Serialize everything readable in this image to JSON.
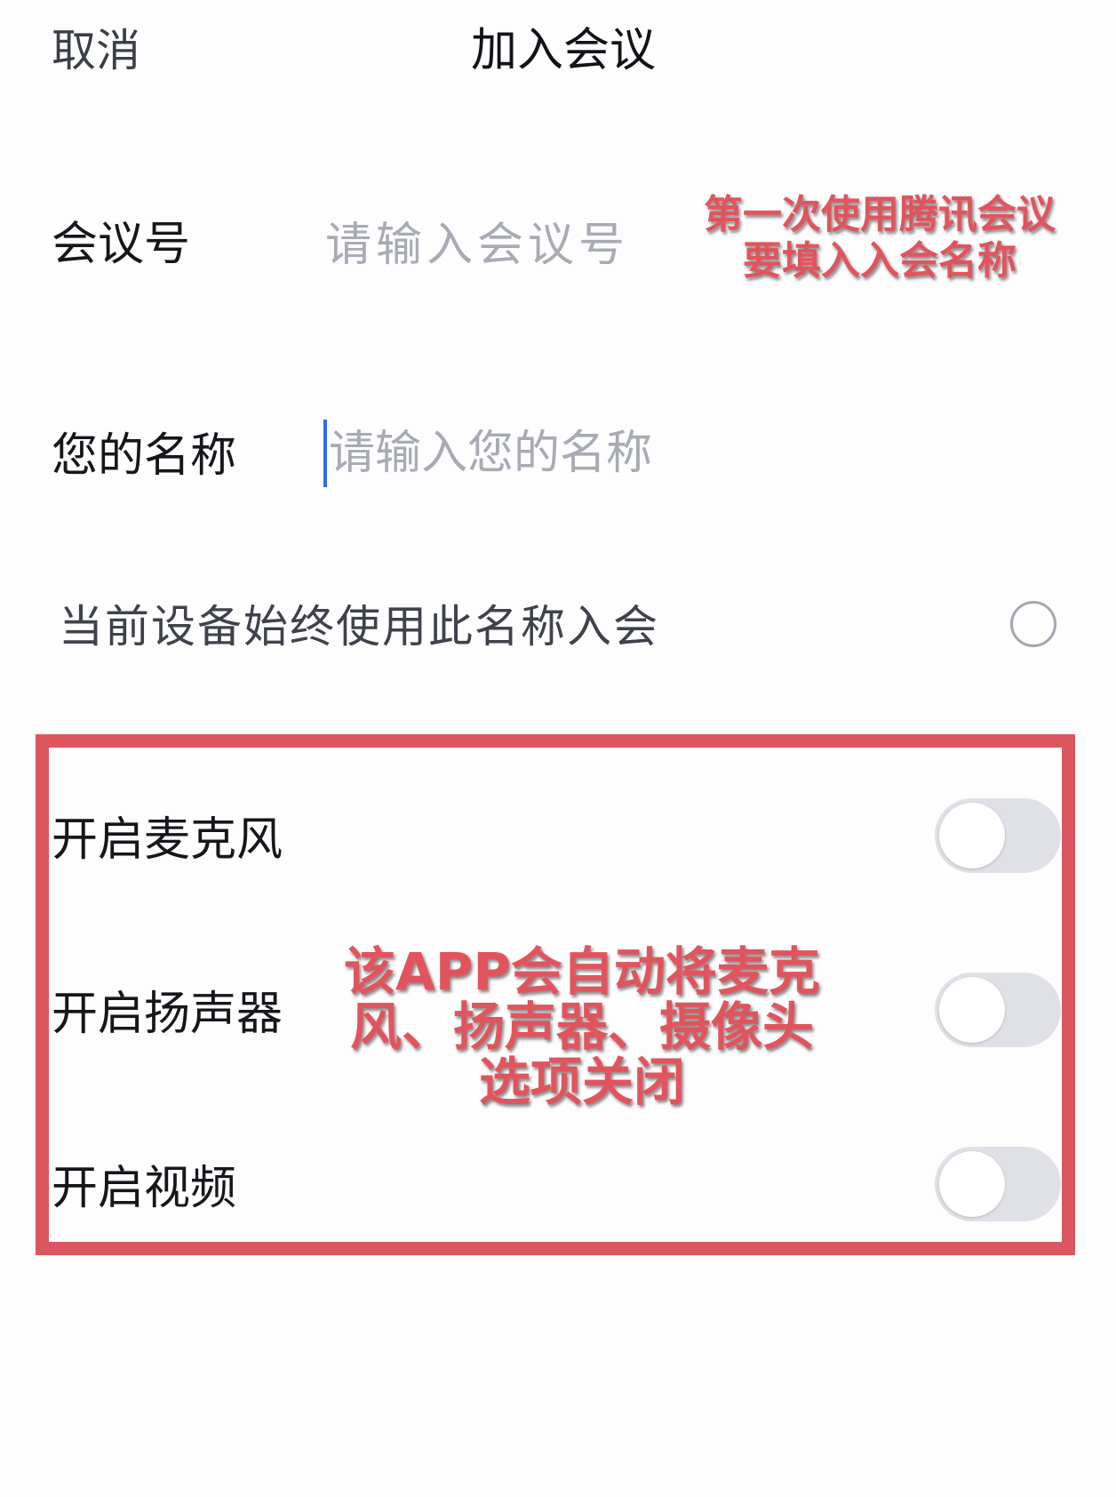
{
  "header": {
    "cancel_label": "取消",
    "title": "加入会议"
  },
  "form": {
    "meeting_id": {
      "label": "会议号",
      "placeholder": "请输入会议号",
      "value": ""
    },
    "display_name": {
      "label": "您的名称",
      "placeholder": "请输入您的名称",
      "value": ""
    },
    "remember_name": {
      "label": "当前设备始终使用此名称入会",
      "checked": false
    }
  },
  "toggles": [
    {
      "label": "开启麦克风",
      "on": false
    },
    {
      "label": "开启扬声器",
      "on": false
    },
    {
      "label": "开启视频",
      "on": false
    }
  ],
  "annotations": {
    "top_line1": "第一次使用腾讯会议",
    "top_line2": "要填入入会名称",
    "middle_line1": "该APP会自动将麦克",
    "middle_line2": "风、扬声器、摄像头",
    "middle_line3": "选项关闭"
  },
  "colors": {
    "annotation": "#e2545d",
    "frame": "#dc5660",
    "cursor": "#2f6bf2",
    "toggle_off": "#dfe1e6"
  }
}
